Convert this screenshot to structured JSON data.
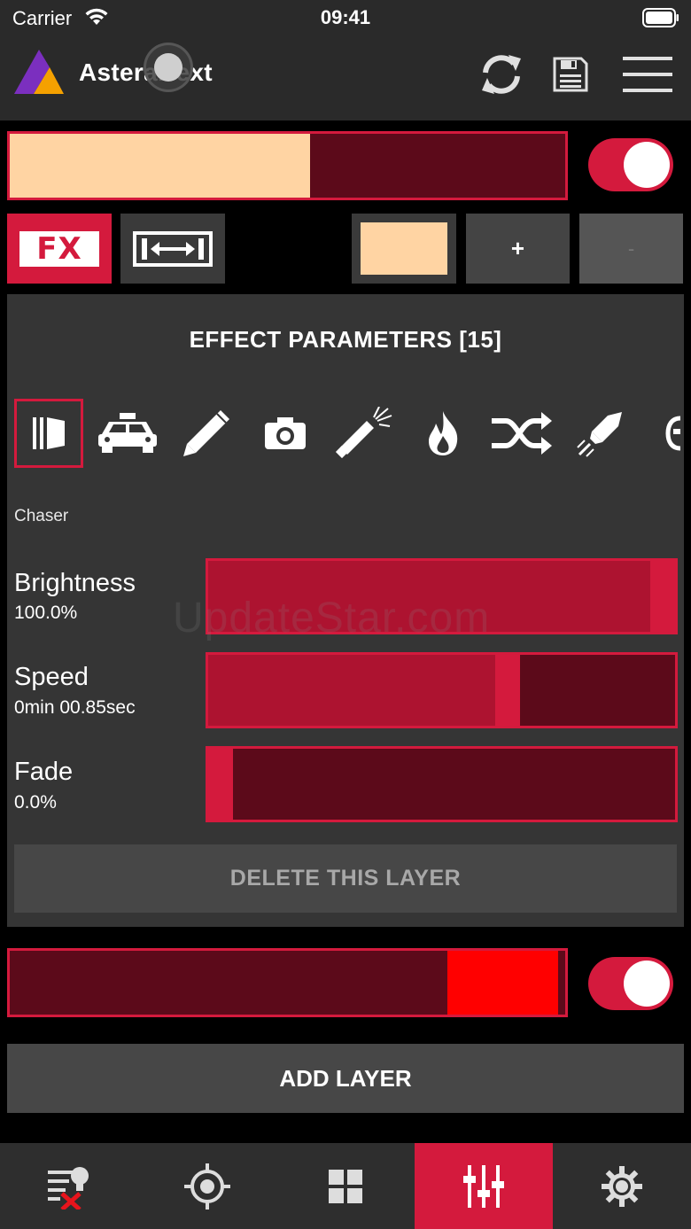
{
  "status": {
    "carrier": "Carrier",
    "time": "09:41"
  },
  "header": {
    "title": "AsteraNext",
    "icons": {
      "logo": "astera-logo",
      "sync": "sync-icon",
      "save": "save-icon",
      "menu": "hamburger-menu-icon"
    }
  },
  "layers": [
    {
      "fill_color": "#ffd4a3",
      "level": 0.54,
      "enabled": true
    },
    {
      "fill_color": "#ff0000",
      "level": 0.2,
      "enabled": true
    }
  ],
  "toolbar": {
    "fx_label": "FX",
    "swatch_color": "#ffd4a3",
    "plus_label": "+",
    "minus_label": "-"
  },
  "panel": {
    "title": "EFFECT PARAMETERS [15]",
    "effects": [
      "chaser-icon",
      "police-car-icon",
      "pencil-icon",
      "camera-icon",
      "welding-torch-icon",
      "fire-icon",
      "shuffle-icon",
      "firework-rocket-icon",
      "more-effects-icon"
    ],
    "selected_effect_name": "Chaser",
    "params": [
      {
        "name": "Brightness",
        "value": "100.0%",
        "level": 1.0
      },
      {
        "name": "Speed",
        "value": "0min 00.85sec",
        "level": 0.65
      },
      {
        "name": "Fade",
        "value": "0.0%",
        "level": 0.0
      }
    ],
    "delete_label": "DELETE THIS LAYER"
  },
  "add_layer_label": "ADD LAYER",
  "watermark": "UpdateStar.com",
  "tabs": [
    {
      "icon": "fixture-list-icon",
      "active": false
    },
    {
      "icon": "target-icon",
      "active": false
    },
    {
      "icon": "grid-icon",
      "active": false
    },
    {
      "icon": "mixer-sliders-icon",
      "active": true
    },
    {
      "icon": "settings-gear-icon",
      "active": false
    }
  ],
  "colors": {
    "accent": "#d41a3d",
    "dark_red": "#5c0a1a",
    "slider_fill": "#ad1330",
    "background": "#000000",
    "panel": "#353535"
  }
}
